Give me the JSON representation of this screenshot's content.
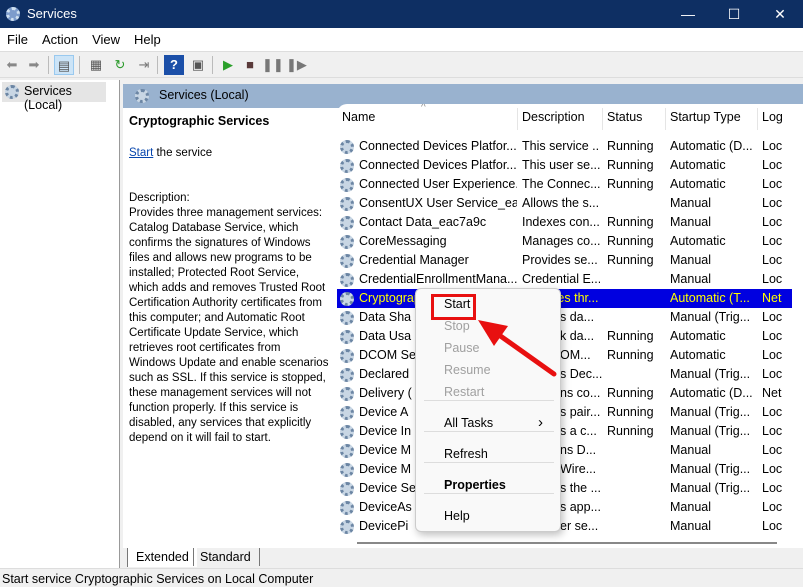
{
  "window": {
    "title": "Services",
    "minimize": "—",
    "maximize": "☐",
    "close": "✕"
  },
  "menubar": [
    "File",
    "Action",
    "View",
    "Help"
  ],
  "toolbar": {
    "icons": [
      "back-icon",
      "forward-icon",
      "show-hide-tree-icon",
      "properties-icon",
      "refresh-icon",
      "export-icon",
      "help-icon",
      "console-icon",
      "start-icon",
      "stop-icon",
      "pause-icon",
      "restart-icon"
    ]
  },
  "tree": {
    "root": "Services (Local)"
  },
  "pane": {
    "header": "Services (Local)"
  },
  "details": {
    "title": "Cryptographic Services",
    "start_link": "Start",
    "start_suffix": " the service",
    "desc_label": "Description:",
    "desc_text": "Provides three management services: Catalog Database Service, which confirms the signatures of Windows files and allows new programs to be installed; Protected Root Service, which adds and removes Trusted Root Certification Authority certificates from this computer; and Automatic Root Certificate Update Service, which retrieves root certificates from Windows Update and enable scenarios such as SSL. If this service is stopped, these management services will not function properly. If this service is disabled, any services that explicitly depend on it will fail to start."
  },
  "columns": [
    "Name",
    "Description",
    "Status",
    "Startup Type",
    "Log"
  ],
  "rows": [
    [
      "Connected Devices Platfor...",
      "This service ...",
      "Running",
      "Automatic (D...",
      "Loc"
    ],
    [
      "Connected Devices Platfor...",
      "This user se...",
      "Running",
      "Automatic",
      "Loc"
    ],
    [
      "Connected User Experience...",
      "The Connec...",
      "Running",
      "Automatic",
      "Loc"
    ],
    [
      "ConsentUX User Service_ea...",
      "Allows the s...",
      "",
      "Manual",
      "Loc"
    ],
    [
      "Contact Data_eac7a9c",
      "Indexes con...",
      "Running",
      "Manual",
      "Loc"
    ],
    [
      "CoreMessaging",
      "Manages co...",
      "Running",
      "Automatic",
      "Loc"
    ],
    [
      "Credential Manager",
      "Provides se...",
      "Running",
      "Manual",
      "Loc"
    ],
    [
      "CredentialEnrollmentMana...",
      "Credential E...",
      "",
      "Manual",
      "Loc"
    ],
    [
      "Cryptographic Services",
      "Provides thr...",
      "",
      "Automatic (T...",
      "Net"
    ],
    [
      "Data Sha",
      "s da...",
      "",
      "Manual (Trig...",
      "Loc"
    ],
    [
      "Data Usa",
      "k da...",
      "Running",
      "Automatic",
      "Loc"
    ],
    [
      "DCOM Se",
      "OM...",
      "Running",
      "Automatic",
      "Loc"
    ],
    [
      "Declared",
      "s Dec...",
      "",
      "Manual (Trig...",
      "Loc"
    ],
    [
      "Delivery (",
      "ns co...",
      "Running",
      "Automatic (D...",
      "Net"
    ],
    [
      "Device A",
      "s pair...",
      "Running",
      "Manual (Trig...",
      "Loc"
    ],
    [
      "Device In",
      "s a c...",
      "Running",
      "Manual (Trig...",
      "Loc"
    ],
    [
      "Device M",
      "ns D...",
      "",
      "Manual",
      "Loc"
    ],
    [
      "Device M",
      "Wire...",
      "",
      "Manual (Trig...",
      "Loc"
    ],
    [
      "Device Se",
      "s the ...",
      "",
      "Manual (Trig...",
      "Loc"
    ],
    [
      "DeviceAs",
      "s app...",
      "",
      "Manual",
      "Loc"
    ],
    [
      "DevicePi",
      "er se...",
      "",
      "Manual",
      "Loc"
    ]
  ],
  "selected_row": 8,
  "context_menu": {
    "items": [
      {
        "label": "Start",
        "enabled": true
      },
      {
        "label": "Stop",
        "enabled": false
      },
      {
        "label": "Pause",
        "enabled": false
      },
      {
        "label": "Resume",
        "enabled": false
      },
      {
        "label": "Restart",
        "enabled": false
      },
      {
        "label": "All Tasks",
        "enabled": true,
        "submenu": true
      },
      {
        "label": "Refresh",
        "enabled": true
      },
      {
        "label": "Properties",
        "enabled": true,
        "bold": true
      },
      {
        "label": "Help",
        "enabled": true
      }
    ],
    "submenu_arrow": "›"
  },
  "tabs": [
    "Extended",
    "Standard"
  ],
  "statusbar": "Start service Cryptographic Services on Local Computer",
  "colors": {
    "titlebar": "#0e2f63",
    "selection": "#0000e0",
    "selection_text": "#ffff00",
    "highlight": "#e81010"
  }
}
